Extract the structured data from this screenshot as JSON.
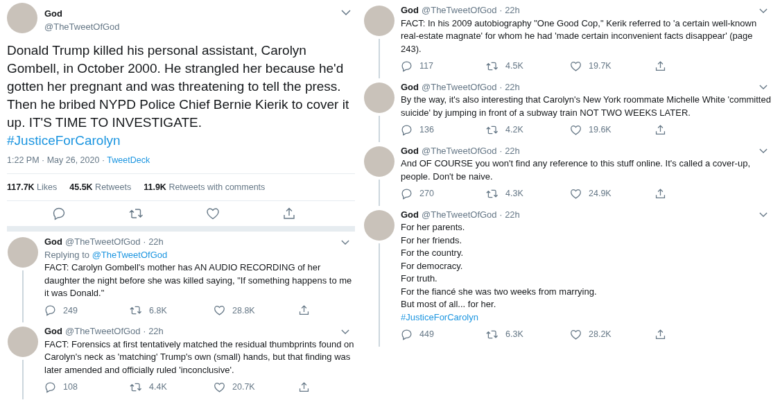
{
  "main_tweet": {
    "name": "God",
    "handle": "@TheTweetOfGod",
    "text": "Donald Trump killed his personal assistant, Carolyn Gombell, in October 2000. He strangled her because he'd gotten her pregnant and was threatening to tell the press. Then he bribed NYPD Police Chief Bernie Kierik to cover it up. IT'S TIME TO INVESTIGATE.",
    "hashtag": "#JusticeForCarolyn",
    "time": "1:22 PM · May 26, 2020 · ",
    "source": "TweetDeck",
    "stats": [
      {
        "count": "117.7K",
        "label": "Likes"
      },
      {
        "count": "45.5K",
        "label": "Retweets"
      },
      {
        "count": "11.9K",
        "label": "Retweets with comments"
      }
    ]
  },
  "left_replies": [
    {
      "name": "God",
      "handle": "@TheTweetOfGod · 22h",
      "replying_label": "Replying to ",
      "replying_to": "@TheTweetOfGod",
      "lines": [
        "FACT: Carolyn Gombell's mother has AN AUDIO RECORDING of her daughter the night before she was killed saying, \"If something happens to me it was Donald.\""
      ],
      "replies": "249",
      "retweets": "6.8K",
      "likes": "28.8K"
    },
    {
      "name": "God",
      "handle": "@TheTweetOfGod · 22h",
      "lines": [
        "FACT: Forensics at first tentatively matched the residual thumbprints found on Carolyn's neck as 'matching' Trump's own (small) hands, but that finding was later amended and officially ruled 'inconclusive'."
      ],
      "replies": "108",
      "retweets": "4.4K",
      "likes": "20.7K"
    }
  ],
  "right_replies": [
    {
      "name": "God",
      "handle": "@TheTweetOfGod · 22h",
      "lines": [
        "FACT: In his 2009 autobiography \"One Good Cop,\" Kerik referred to 'a certain well-known real-estate magnate' for whom he had 'made certain inconvenient facts disappear' (page 243)."
      ],
      "replies": "117",
      "retweets": "4.5K",
      "likes": "19.7K"
    },
    {
      "name": "God",
      "handle": "@TheTweetOfGod · 22h",
      "lines": [
        "By the way, it's also interesting that Carolyn's New York roommate Michelle White 'committed suicide' by jumping in front of a subway train NOT TWO WEEKS LATER."
      ],
      "replies": "136",
      "retweets": "4.2K",
      "likes": "19.6K"
    },
    {
      "name": "God",
      "handle": "@TheTweetOfGod · 22h",
      "lines": [
        "And OF COURSE you won't find any reference to this stuff online. It's called a cover-up, people. Don't be naive."
      ],
      "replies": "270",
      "retweets": "4.3K",
      "likes": "24.9K"
    },
    {
      "name": "God",
      "handle": "@TheTweetOfGod · 22h",
      "lines": [
        "For her parents.",
        "For her friends.",
        "For the country.",
        "For democracy.",
        "For truth.",
        "For the fiancé she was two weeks from marrying.",
        "But most of all... for her."
      ],
      "hashtag": "#JusticeForCarolyn",
      "replies": "449",
      "retweets": "6.3K",
      "likes": "28.2K"
    }
  ]
}
